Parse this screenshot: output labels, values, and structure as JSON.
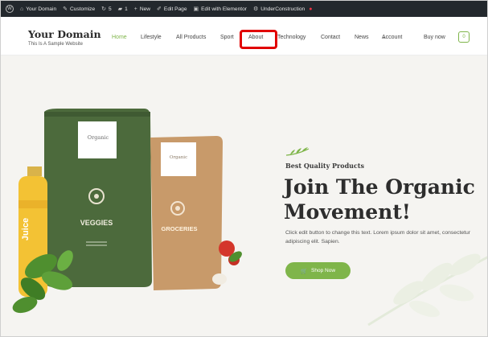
{
  "admin_bar": {
    "items": [
      {
        "label": "Your Domain",
        "icon": "home-icon"
      },
      {
        "label": "Customize",
        "icon": "brush-icon"
      },
      {
        "label": "5",
        "icon": "refresh-icon"
      },
      {
        "label": "1",
        "icon": "comment-icon"
      },
      {
        "label": "New",
        "icon": "plus-icon"
      },
      {
        "label": "Edit Page",
        "icon": "pencil-icon"
      },
      {
        "label": "Edit with Elementor",
        "icon": "elementor-icon"
      },
      {
        "label": "UnderConstruction",
        "icon": "gear-icon"
      }
    ]
  },
  "header": {
    "site_title": "Your Domain",
    "tagline": "This Is A Sample Website",
    "nav": [
      "Home",
      "Lifestyle",
      "All Products",
      "Sport",
      "About",
      "Technology",
      "Contact",
      "News",
      "Account",
      "Buy now"
    ],
    "cart_count": "0",
    "active_color": "#7fb54a",
    "highlight_color": "#e10000"
  },
  "hero": {
    "kicker": "Best Quality Products",
    "headline": "Join The Organic Movement!",
    "body": "Click edit button to change this text. Lorem ipsum dolor sit amet, consectetur adipiscing elit. Sapien.",
    "button": "Shop Now",
    "products": {
      "bag1_badge": "Organic",
      "bag1_label": "VEGGIES",
      "bag2_badge": "Organic",
      "bag2_label": "GROCERIES",
      "bottle_label": "Juice"
    },
    "accent_color": "#7fb54a"
  }
}
